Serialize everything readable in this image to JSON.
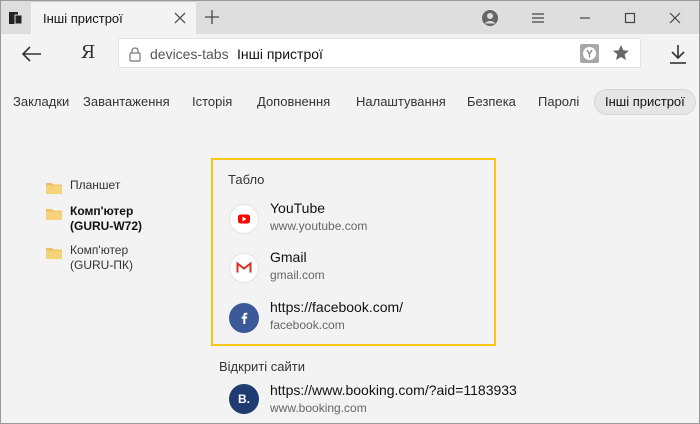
{
  "tab": {
    "title": "Інші пристрої"
  },
  "address": {
    "host": "devices-tabs",
    "title": "Інші пристрої"
  },
  "navigation": {
    "yandex_label": "Я"
  },
  "settings_tabs": [
    {
      "label": "Закладки"
    },
    {
      "label": "Завантаження"
    },
    {
      "label": "Історія"
    },
    {
      "label": "Доповнення"
    },
    {
      "label": "Налаштування"
    },
    {
      "label": "Безпека"
    },
    {
      "label": "Паролі"
    },
    {
      "label": "Інші пристрої",
      "active": true
    }
  ],
  "devices": [
    {
      "line1": "Планшет",
      "line2": ""
    },
    {
      "line1": "Комп'ютер",
      "line2": "(GURU-W72)",
      "selected": true
    },
    {
      "line1": "Комп'ютер",
      "line2": "(GURU-ПК)"
    }
  ],
  "tablo": {
    "heading": "Табло",
    "sites": [
      {
        "title": "YouTube",
        "url": "www.youtube.com",
        "icon": "youtube-icon",
        "color": "#ff0000"
      },
      {
        "title": "Gmail",
        "url": "gmail.com",
        "icon": "gmail-icon",
        "color": "#d93025"
      },
      {
        "title": "https://facebook.com/",
        "url": "facebook.com",
        "icon": "facebook-icon",
        "color": "#3b5998"
      }
    ]
  },
  "open_sites": {
    "heading": "Відкриті сайти",
    "sites": [
      {
        "title": "https://www.booking.com/?aid=1183933",
        "url": "www.booking.com",
        "icon_text": "B.",
        "color": "#1e3c72"
      }
    ]
  },
  "colors": {
    "highlight_border": "#f5c518",
    "background": "#f3f3f3",
    "titlebar": "#dedede"
  }
}
